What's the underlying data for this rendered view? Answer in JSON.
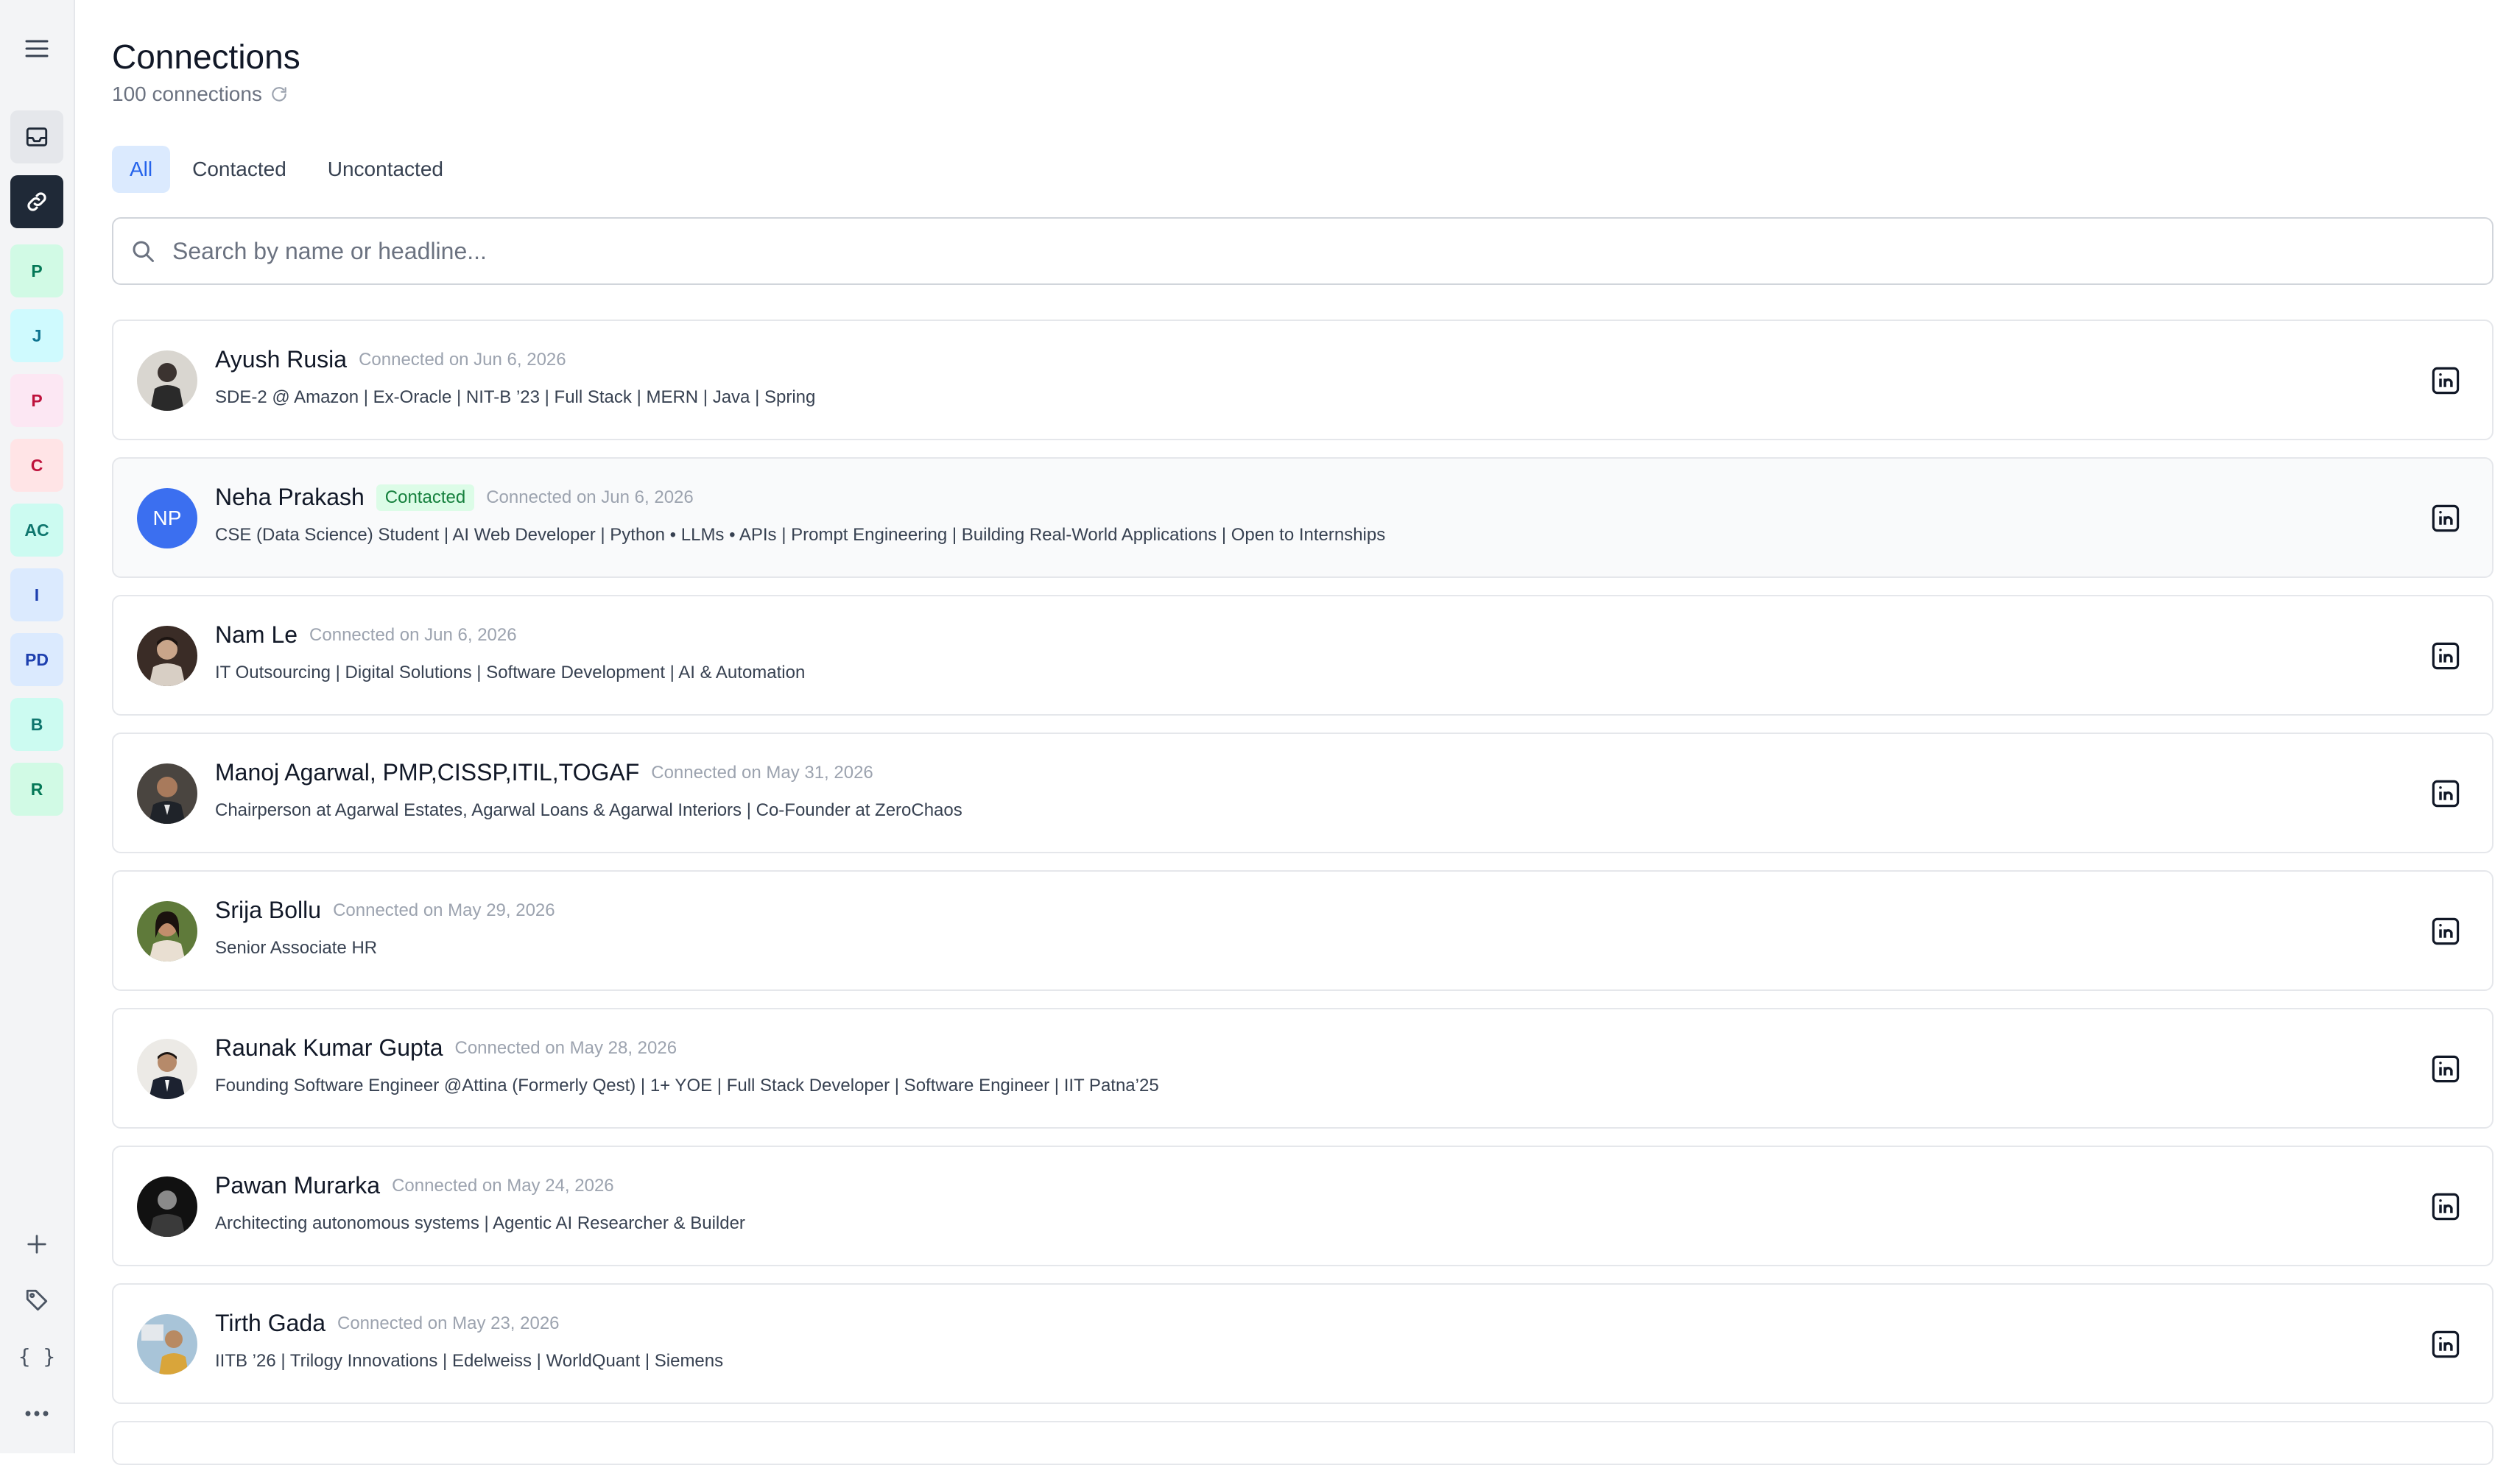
{
  "sidebar": {
    "workspaces": [
      {
        "label": "P"
      },
      {
        "label": "J"
      },
      {
        "label": "P"
      },
      {
        "label": "C"
      },
      {
        "label": "AC"
      },
      {
        "label": "I"
      },
      {
        "label": "PD"
      },
      {
        "label": "B"
      },
      {
        "label": "R"
      }
    ],
    "json_label": "{ }"
  },
  "header": {
    "title": "Connections",
    "count": "100 connections"
  },
  "tabs": [
    {
      "label": "All",
      "active": true
    },
    {
      "label": "Contacted",
      "active": false
    },
    {
      "label": "Uncontacted",
      "active": false
    }
  ],
  "search": {
    "placeholder": "Search by name or headline..."
  },
  "connections": [
    {
      "name": "Ayush Rusia",
      "date": "Connected on Jun 6, 2026",
      "headline": "SDE-2 @ Amazon | Ex-Oracle | NIT-B ’23 | Full Stack | MERN | Java | Spring"
    },
    {
      "name": "Neha Prakash",
      "initials": "NP",
      "badge": "Contacted",
      "date": "Connected on Jun 6, 2026",
      "headline": "CSE (Data Science) Student | AI Web Developer | Python • LLMs • APIs | Prompt Engineering | Building Real-World Applications | Open to Internships"
    },
    {
      "name": "Nam Le",
      "date": "Connected on Jun 6, 2026",
      "headline": "IT Outsourcing | Digital Solutions | Software Development | AI & Automation"
    },
    {
      "name": "Manoj Agarwal, PMP,CISSP,ITIL,TOGAF",
      "date": "Connected on May 31, 2026",
      "headline": "Chairperson at Agarwal Estates, Agarwal Loans & Agarwal Interiors | Co-Founder at ZeroChaos"
    },
    {
      "name": "Srija Bollu",
      "date": "Connected on May 29, 2026",
      "headline": "Senior Associate HR"
    },
    {
      "name": "Raunak Kumar Gupta",
      "date": "Connected on May 28, 2026",
      "headline": "Founding Software Engineer @Attina (Formerly Qest) | 1+ YOE | Full Stack Developer | Software Engineer | IIT Patna’25"
    },
    {
      "name": "Pawan Murarka",
      "date": "Connected on May 24, 2026",
      "headline": "Architecting autonomous systems | Agentic AI Researcher & Builder"
    },
    {
      "name": "Tirth Gada",
      "date": "Connected on May 23, 2026",
      "headline": "IITB ’26 | Trilogy Innovations | Edelweiss | WorldQuant | Siemens"
    }
  ]
}
